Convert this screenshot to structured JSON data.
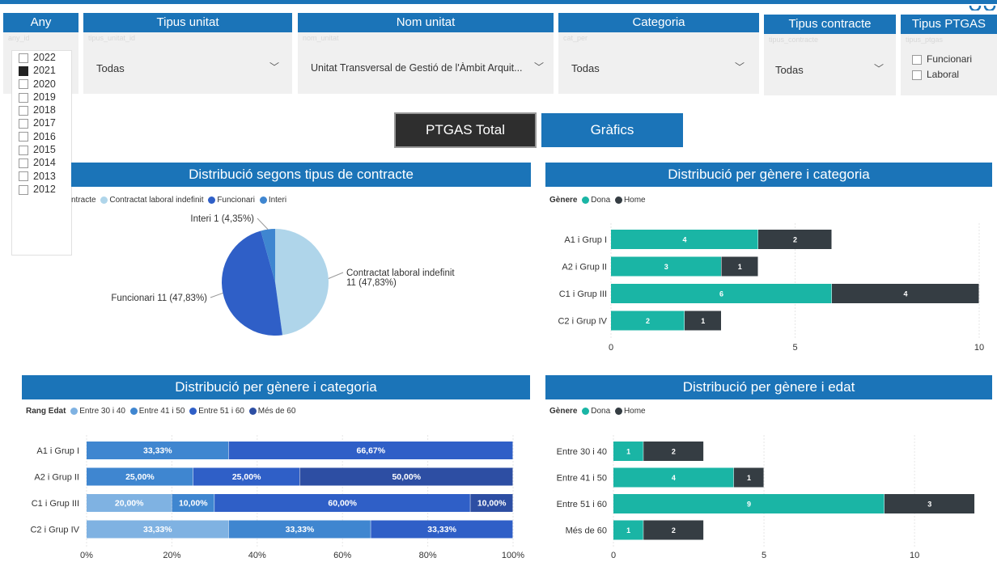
{
  "slicers": {
    "any": {
      "title": "Any",
      "sub": "any_id",
      "value": "2021"
    },
    "tipus_unitat": {
      "title": "Tipus unitat",
      "sub": "tipus_unitat_id",
      "value": "Todas"
    },
    "nom_unitat": {
      "title": "Nom unitat",
      "sub": "nom_unitat",
      "value": "Unitat Transversal de Gestió de l'Àmbit Arquit..."
    },
    "categoria": {
      "title": "Categoria",
      "sub": "cat_per",
      "value": "Todas"
    },
    "tipus_contracte": {
      "title": "Tipus contracte",
      "sub": "tipus_contracte",
      "value": "Todas"
    },
    "tipus_ptgas": {
      "title": "Tipus PTGAS",
      "sub": "tipus_ptgas",
      "options": [
        "Funcionari",
        "Laboral"
      ]
    }
  },
  "year_options": [
    {
      "label": "2022",
      "checked": false
    },
    {
      "label": "2021",
      "checked": true
    },
    {
      "label": "2020",
      "checked": false
    },
    {
      "label": "2019",
      "checked": false
    },
    {
      "label": "2018",
      "checked": false
    },
    {
      "label": "2017",
      "checked": false
    },
    {
      "label": "2016",
      "checked": false
    },
    {
      "label": "2015",
      "checked": false
    },
    {
      "label": "2014",
      "checked": false
    },
    {
      "label": "2013",
      "checked": false
    },
    {
      "label": "2012",
      "checked": false
    }
  ],
  "buttons": {
    "ptgas_total": "PTGAS Total",
    "grafics": "Gràfics"
  },
  "colors": {
    "accent": "#1b74b8",
    "dona": "#1ab5a5",
    "home": "#353d43"
  },
  "panels": {
    "p1": {
      "title": "Distribució segons tipus de contracte",
      "legend_title": "Tipus contracte",
      "legend_visible": "ntracte"
    },
    "p2": {
      "title": "Distribució per gènere i categoria",
      "legend_title": "Gènere"
    },
    "p3": {
      "title": "Distribució per gènere i categoria",
      "legend_title": "Rang Edat"
    },
    "p4": {
      "title": "Distribució per gènere i edat",
      "legend_title": "Gènere"
    }
  },
  "chart_data": [
    {
      "type": "pie",
      "title": "Distribució segons tipus de contracte",
      "legend_title": "Tipus contracte",
      "series": [
        {
          "name": "Contractat laboral indefinit",
          "value": 11,
          "pct": "47,83%",
          "color": "#afd5ea",
          "label1": "Contractat laboral indefinit",
          "label2": "11 (47,83%)"
        },
        {
          "name": "Funcionari",
          "value": 11,
          "pct": "47,83%",
          "color": "#2f5fc7",
          "label1": "Funcionari 11 (47,83%)"
        },
        {
          "name": "Interi",
          "value": 1,
          "pct": "4,35%",
          "color": "#3f86d0",
          "label1": "Interi 1 (4,35%)"
        }
      ]
    },
    {
      "type": "bar",
      "orientation": "horizontal",
      "stacked": true,
      "title": "Distribució per gènere i categoria",
      "legend_title": "Gènere",
      "categories": [
        "A1 i Grup I",
        "A2 i Grup II",
        "C1 i Grup III",
        "C2 i Grup IV"
      ],
      "series": [
        {
          "name": "Dona",
          "values": [
            4,
            3,
            6,
            2
          ],
          "color": "#1ab5a5"
        },
        {
          "name": "Home",
          "values": [
            2,
            1,
            4,
            1
          ],
          "color": "#353d43"
        }
      ],
      "xlim": [
        0,
        10
      ],
      "xticks": [
        "0",
        "5",
        "10"
      ]
    },
    {
      "type": "bar",
      "orientation": "horizontal",
      "stacked": true,
      "percent": true,
      "title": "Distribució per gènere i categoria",
      "legend_title": "Rang Edat",
      "categories": [
        "A1 i Grup I",
        "A2 i Grup II",
        "C1 i Grup III",
        "C2 i Grup IV"
      ],
      "series": [
        {
          "name": "Entre 30 i 40",
          "values": [
            0,
            0,
            20,
            33.33
          ],
          "labels": [
            "",
            "",
            "20,00%",
            "33,33%"
          ],
          "color": "#7fb2e2"
        },
        {
          "name": "Entre 41 i 50",
          "values": [
            33.33,
            25,
            10,
            33.33
          ],
          "labels": [
            "33,33%",
            "25,00%",
            "10,00%",
            "33,33%"
          ],
          "color": "#3f86d0"
        },
        {
          "name": "Entre 51 i 60",
          "values": [
            66.67,
            25,
            60,
            33.33
          ],
          "labels": [
            "66,67%",
            "25,00%",
            "60,00%",
            "33,33%"
          ],
          "color": "#2f5fc7"
        },
        {
          "name": "Més de 60",
          "values": [
            0,
            50,
            10,
            0
          ],
          "labels": [
            "",
            "50,00%",
            "10,00%",
            ""
          ],
          "color": "#2d4ea3"
        }
      ],
      "xlim": [
        0,
        100
      ],
      "xticks": [
        "0%",
        "20%",
        "40%",
        "60%",
        "80%",
        "100%"
      ]
    },
    {
      "type": "bar",
      "orientation": "horizontal",
      "stacked": true,
      "title": "Distribució per gènere i edat",
      "legend_title": "Gènere",
      "categories": [
        "Entre 30 i 40",
        "Entre 41 i 50",
        "Entre 51 i 60",
        "Més de 60"
      ],
      "series": [
        {
          "name": "Dona",
          "values": [
            1,
            4,
            9,
            1
          ],
          "color": "#1ab5a5"
        },
        {
          "name": "Home",
          "values": [
            2,
            1,
            3,
            2
          ],
          "color": "#353d43"
        }
      ],
      "xlim": [
        0,
        12.2
      ],
      "xticks": [
        "0",
        "5",
        "10"
      ]
    }
  ]
}
